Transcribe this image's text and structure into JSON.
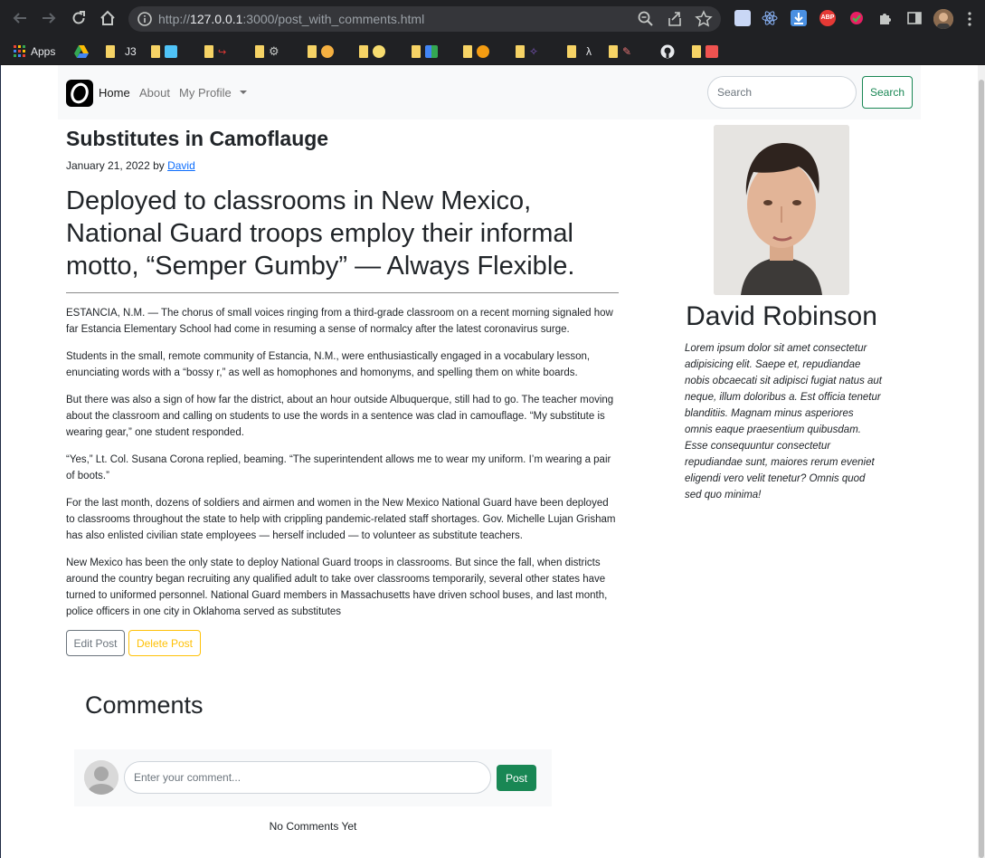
{
  "browser": {
    "url_prefix": "http://",
    "url_host": "127.0.0.1",
    "url_rest": ":3000/post_with_comments.html",
    "bookmarks": [
      {
        "label": "Apps",
        "icon": "apps-grid-icon"
      },
      {
        "label": "",
        "icon": "google-drive-icon"
      },
      {
        "label": "J3",
        "icon": "folder-icon"
      },
      {
        "label": "",
        "icon": "folder-icon"
      },
      {
        "label": "",
        "icon": "folder-icon"
      },
      {
        "label": "",
        "icon": "folder-icon"
      },
      {
        "label": "",
        "icon": "folder-icon"
      },
      {
        "label": "",
        "icon": "folder-icon"
      },
      {
        "label": "",
        "icon": "folder-icon"
      },
      {
        "label": "",
        "icon": "folder-icon"
      },
      {
        "label": "",
        "icon": "folder-icon"
      },
      {
        "label": "",
        "icon": "folder-icon"
      },
      {
        "label": "λ",
        "icon": "folder-icon"
      },
      {
        "label": "",
        "icon": "folder-icon"
      },
      {
        "label": "",
        "icon": "github-icon"
      },
      {
        "label": "",
        "icon": "folder-icon"
      }
    ]
  },
  "navbar": {
    "links": [
      "Home",
      "About",
      "My Profile"
    ],
    "search_placeholder": "Search",
    "search_button": "Search"
  },
  "post": {
    "title": "Substitutes in Camoflauge",
    "date": "January 21, 2022 by",
    "author_link": "David",
    "lead": "Deployed to classrooms in New Mexico, National Guard troops employ their informal motto, “Semper Gumby” — Always Flexible.",
    "paragraphs": [
      "ESTANCIA, N.M. — The chorus of small voices ringing from a third-grade classroom on a recent morning signaled how far Estancia Elementary School had come in resuming a sense of normalcy after the latest coronavirus surge.",
      "Students in the small, remote community of Estancia, N.M., were enthusiastically engaged in a vocabulary lesson, enunciating words with a “bossy r,” as well as homophones and homonyms, and spelling them on white boards.",
      "But there was also a sign of how far the district, about an hour outside Albuquerque, still had to go. The teacher moving about the classroom and calling on students to use the words in a sentence was clad in camouflage. “My substitute is wearing gear,” one student responded.",
      "“Yes,” Lt. Col. Susana Corona replied, beaming. “The superintendent allows me to wear my uniform. I’m wearing a pair of boots.”",
      "For the last month, dozens of soldiers and airmen and women in the New Mexico National Guard have been deployed to classrooms throughout the state to help with crippling pandemic-related staff shortages. Gov. Michelle Lujan Grisham has also enlisted civilian state employees — herself included — to volunteer as substitute teachers.",
      "New Mexico has been the only state to deploy National Guard troops in classrooms. But since the fall, when districts around the country began recruiting any qualified adult to take over classrooms temporarily, several other states have turned to uniformed personnel. National Guard members in Massachusetts have driven school buses, and last month, police officers in one city in Oklahoma served as substitutes"
    ],
    "edit_button": "Edit Post",
    "delete_button": "Delete Post"
  },
  "author": {
    "name": "David Robinson",
    "bio": "Lorem ipsum dolor sit amet consectetur adipisicing elit. Saepe et, repudiandae nobis obcaecati sit adipisci fugiat natus aut neque, illum doloribus a. Est officia tenetur blanditiis. Magnam minus asperiores omnis eaque praesentium quibusdam. Esse consequuntur consectetur repudiandae sunt, maiores rerum eveniet eligendi vero velit tenetur? Omnis quod sed quo minima!"
  },
  "comments": {
    "heading": "Comments",
    "input_placeholder": "Enter your comment...",
    "post_button": "Post",
    "empty_text": "No Comments Yet"
  },
  "colors": {
    "success": "#198754",
    "warning": "#ffc107",
    "secondary": "#6c757d",
    "link": "#0d6efd",
    "chrome_bg": "#202124"
  }
}
